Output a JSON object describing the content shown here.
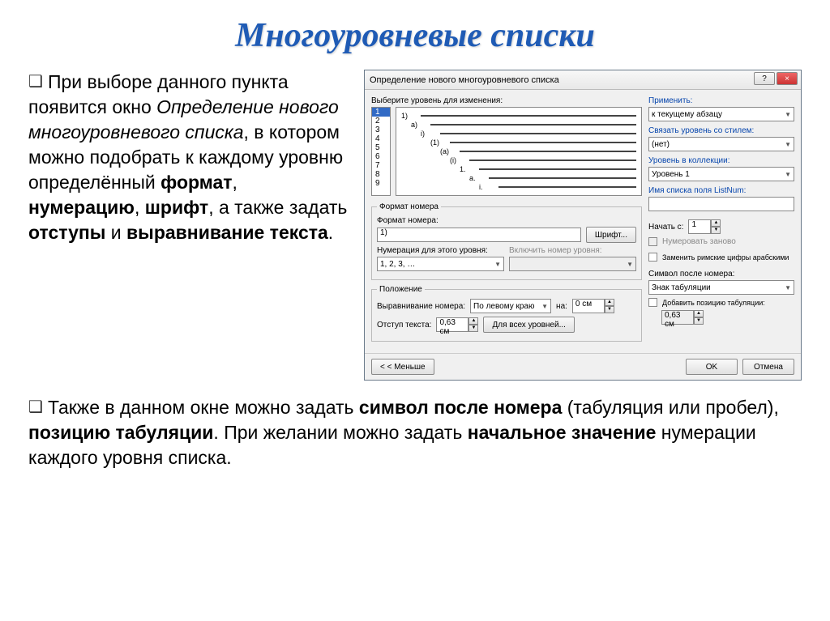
{
  "title": "Многоуровневые списки",
  "para1": {
    "pre": "При выборе данного пункта появится окно ",
    "italic": "Определение нового многоуровневого списка",
    "mid": ", в котором можно подобрать к каждому уровню определённый ",
    "b1": "формат",
    "s1": ", ",
    "b2": "нумерацию",
    "s2": ", ",
    "b3": "шрифт",
    "s3": ", а также задать ",
    "b4": "отступы",
    "s4": " и ",
    "b5": "выравнивание текста",
    "end": "."
  },
  "para2": {
    "pre": "Также в данном окне можно задать ",
    "b1": "символ после номера",
    "mid1": " (табуляция или пробел), ",
    "b2": "позицию табуляции",
    "mid2": ". При желании можно  задать ",
    "b3": "начальное значение",
    "end": " нумерации каждого уровня списка."
  },
  "dialog": {
    "title": "Определение нового многоуровневого списка",
    "help": "?",
    "close": "×",
    "select_level": "Выберите уровень для изменения:",
    "levels": [
      "1",
      "2",
      "3",
      "4",
      "5",
      "6",
      "7",
      "8",
      "9"
    ],
    "preview_labels": [
      "1)",
      "a)",
      "i)",
      "(1)",
      "(a)",
      "(i)",
      "1.",
      "a.",
      "i."
    ],
    "apply_to": "Применить:",
    "apply_val": "к текущему абзацу",
    "link_style": "Связать уровень со стилем:",
    "link_val": "(нет)",
    "level_collection": "Уровень в коллекции:",
    "level_col_val": "Уровень 1",
    "listnum": "Имя списка поля ListNum:",
    "format_legend": "Формат номера",
    "format_label": "Формат номера:",
    "format_val": "1)",
    "font_btn": "Шрифт...",
    "start_at": "Начать с:",
    "start_val": "1",
    "restart": "Нумеровать заново",
    "num_style": "Нумерация для этого уровня:",
    "num_style_val": "1, 2, 3, …",
    "include_level": "Включить номер уровня:",
    "replace_roman": "Заменить римские цифры арабскими",
    "position_legend": "Положение",
    "align_label": "Выравнивание номера:",
    "align_val": "По левому краю",
    "at": "на:",
    "at_val": "0 см",
    "symbol_after": "Символ после номера:",
    "symbol_val": "Знак табуляции",
    "indent_label": "Отступ текста:",
    "indent_val": "0,63 см",
    "all_levels": "Для всех уровней...",
    "add_tab": "Добавить позицию табуляции:",
    "tab_val": "0,63 см",
    "less": "< < Меньше",
    "ok": "OK",
    "cancel": "Отмена"
  }
}
